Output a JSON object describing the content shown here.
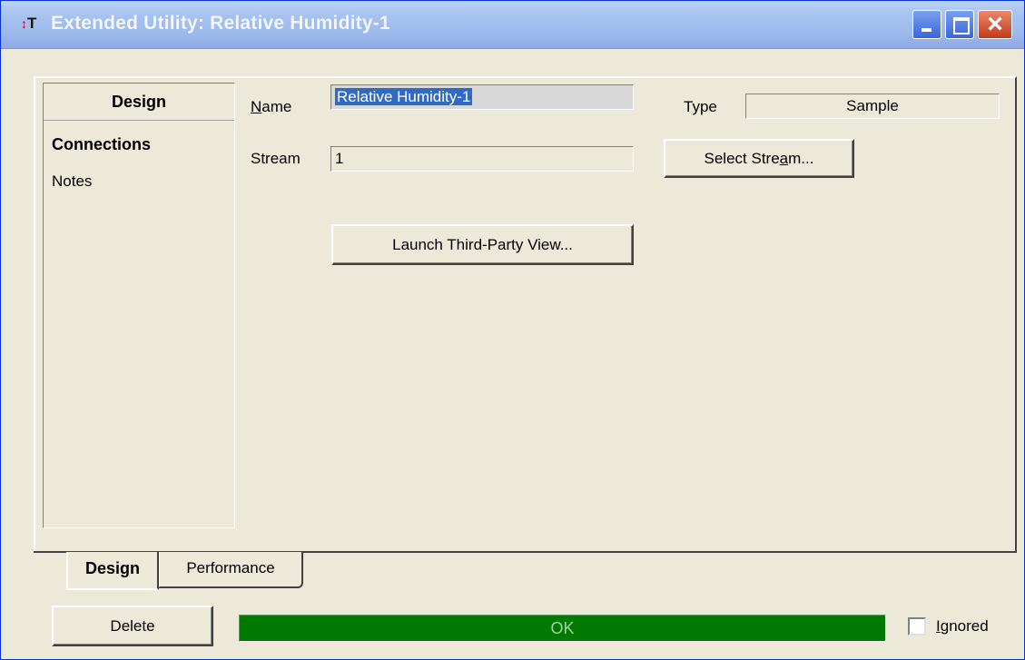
{
  "window": {
    "title": "Extended Utility: Relative Humidity-1",
    "icon": "hysys-app-icon"
  },
  "nav": {
    "header": "Design",
    "items": [
      {
        "label": "Connections",
        "selected": true
      },
      {
        "label": "Notes",
        "selected": false
      }
    ]
  },
  "form": {
    "name_label_hotkey": "N",
    "name_label_rest": "ame",
    "name_value": "Relative Humidity-1",
    "type_label": "Type",
    "type_value": "Sample",
    "stream_label": "Stream",
    "stream_value": "1",
    "select_stream_pre": "Select Stre",
    "select_stream_hotkey": "a",
    "select_stream_post": "m...",
    "launch_label": "Launch Third-Party View..."
  },
  "tabs": [
    {
      "label": "Design",
      "active": true
    },
    {
      "label": "Performance",
      "active": false
    }
  ],
  "footer": {
    "delete_label": "Delete",
    "status_text": "OK",
    "status_color": "#007900",
    "ignored_hotkey": "I",
    "ignored_rest": "gnored",
    "ignored_checked": false
  }
}
